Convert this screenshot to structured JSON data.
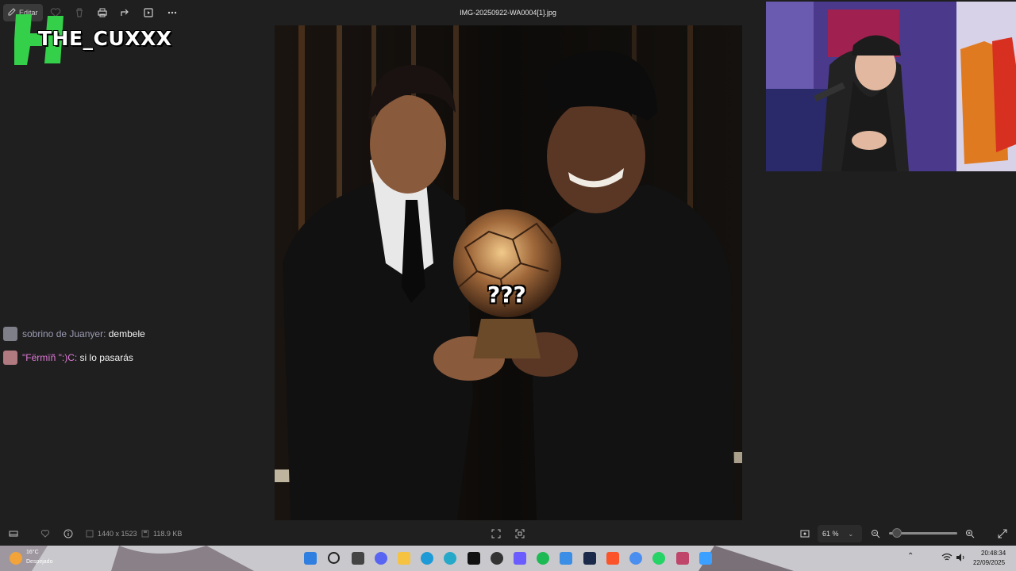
{
  "window": {
    "file_name": "IMG-20250922-WA0004[1].jpg",
    "edit_label": "Editar"
  },
  "overlay": {
    "channel_name": "THE_CUXXX",
    "image_caption": "???"
  },
  "chat": [
    {
      "user": "sobrino de Juanyer:",
      "message": "dembele"
    },
    {
      "user": "\"Fërmïñ \":)C:",
      "message": "si lo pasarás"
    }
  ],
  "status": {
    "dimensions": "1440 x 1523",
    "file_size": "118.9 KB",
    "zoom": "61 %"
  },
  "taskbar": {
    "temperature": "16°C",
    "weather": "Despejado",
    "time": "20:48:34",
    "date": "22/09/2025"
  },
  "colors": {
    "logo_green": "#35d04a",
    "background": "#1f1f1f",
    "taskbar": "#cfcfd2"
  }
}
